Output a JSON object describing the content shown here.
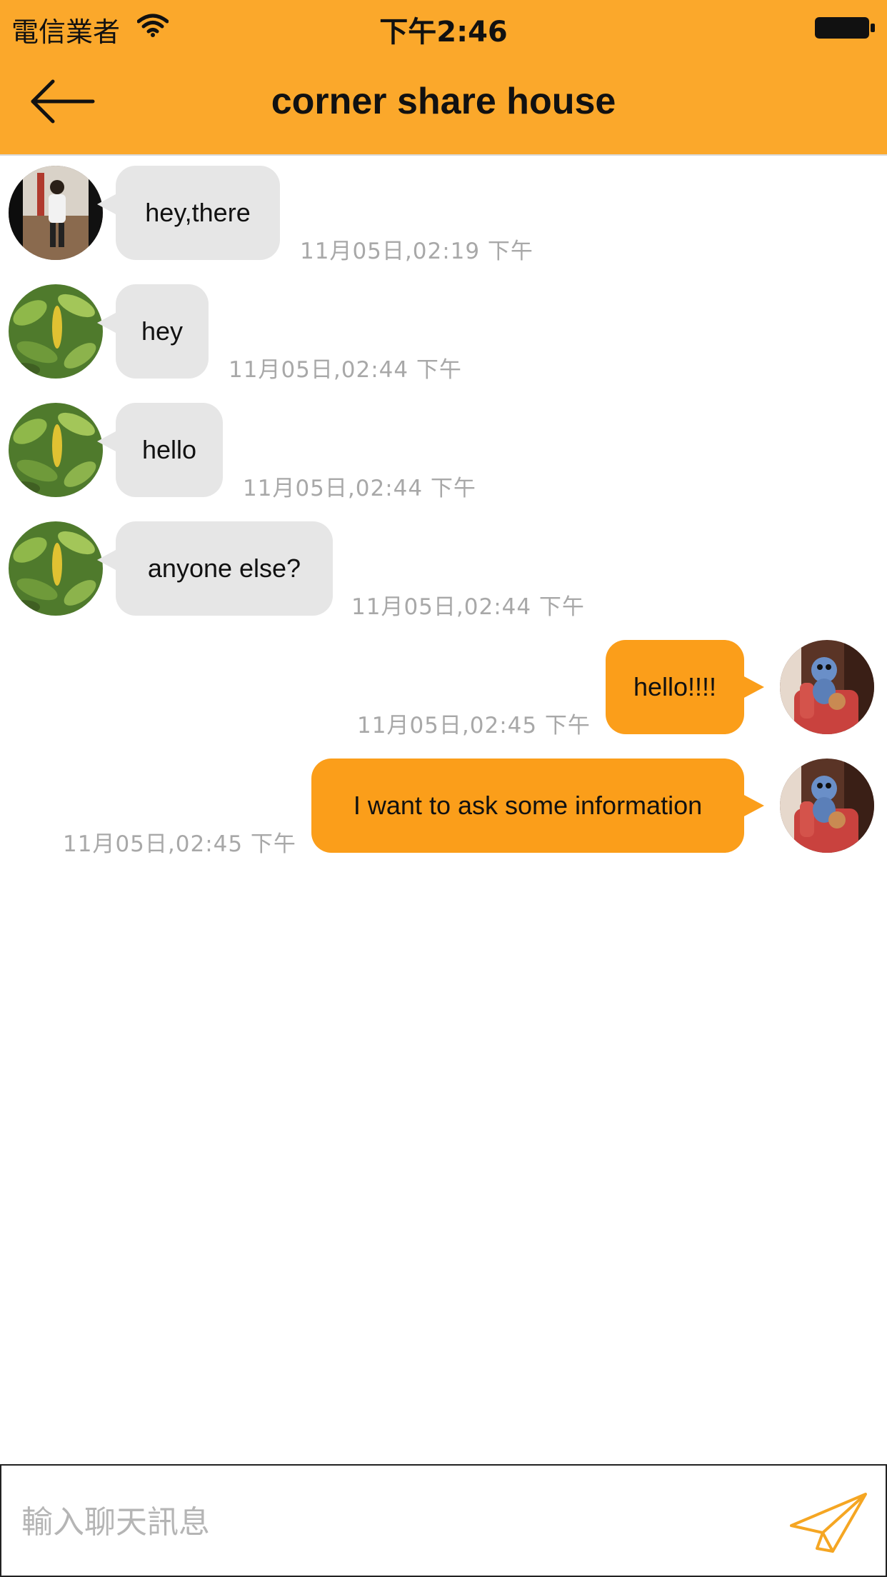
{
  "status_bar": {
    "carrier": "電信業者",
    "time": "下午2:46"
  },
  "header": {
    "title": "corner share house"
  },
  "messages": [
    {
      "side": "in",
      "avatar": "person",
      "text": "hey,there",
      "time": "11月05日,02:19 下午"
    },
    {
      "side": "in",
      "avatar": "plant",
      "text": "hey",
      "time": "11月05日,02:44 下午"
    },
    {
      "side": "in",
      "avatar": "plant",
      "text": "hello",
      "time": "11月05日,02:44 下午"
    },
    {
      "side": "in",
      "avatar": "plant",
      "text": "anyone else?",
      "time": "11月05日,02:44 下午"
    },
    {
      "side": "out",
      "avatar": "toy",
      "text": "hello!!!!",
      "time": "11月05日,02:45 下午"
    },
    {
      "side": "out",
      "avatar": "toy",
      "text": "I want to ask some information",
      "time": "11月05日,02:45 下午"
    }
  ],
  "composer": {
    "placeholder": "輸入聊天訊息",
    "value": ""
  },
  "colors": {
    "header": "#fba82b",
    "outgoing_bubble": "#fb9e1a",
    "incoming_bubble": "#e6e6e6",
    "send_icon": "#f5a623"
  },
  "icons": {
    "back": "arrow-left-icon",
    "send": "paper-plane-icon",
    "wifi": "wifi-icon",
    "battery": "battery-icon"
  }
}
